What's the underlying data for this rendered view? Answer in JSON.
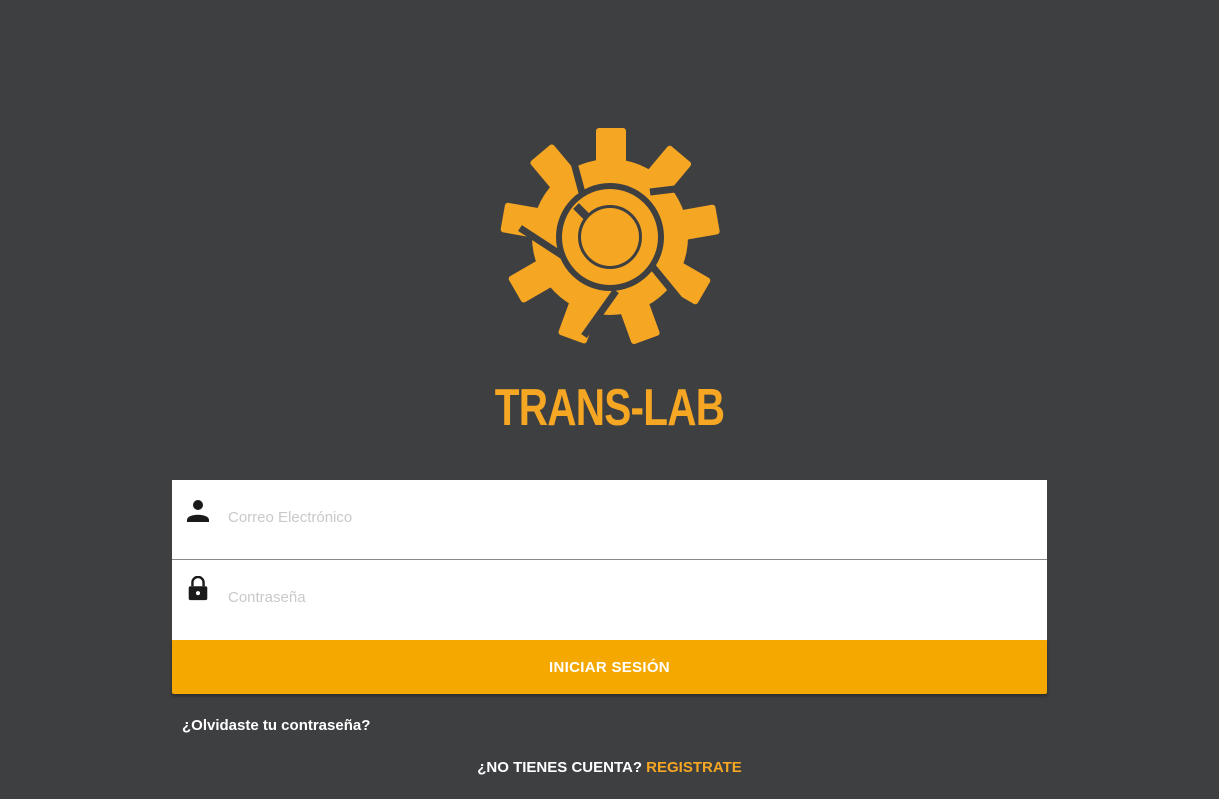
{
  "colors": {
    "background": "#3e3f41",
    "accent": "#f5a623",
    "button": "#f5a800",
    "field_bg": "#ffffff"
  },
  "brand": {
    "logo_icon": "gear-logo-icon",
    "title": "TRANS-LAB"
  },
  "form": {
    "email": {
      "icon": "person-icon",
      "placeholder": "Correo Electrónico",
      "value": ""
    },
    "password": {
      "icon": "lock-icon",
      "placeholder": "Contraseña",
      "value": ""
    },
    "submit_label": "INICIAR SESIÓN"
  },
  "forgot_password": "¿Olvidaste tu contraseña?",
  "signup": {
    "question": "¿NO TIENES CUENTA?",
    "link_label": "REGISTRATE"
  }
}
